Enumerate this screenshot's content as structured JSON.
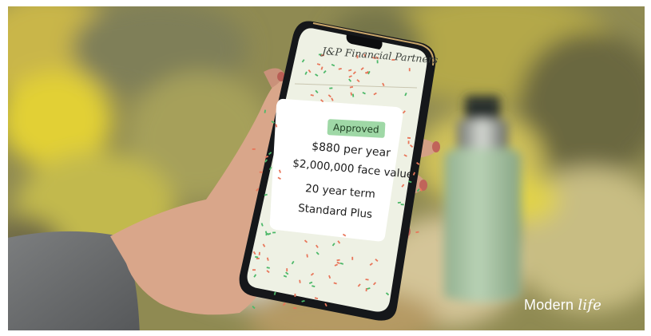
{
  "phone_screen": {
    "header_title": "J&P Financial Partners",
    "status_badge": "Approved",
    "details": [
      "$880 per year",
      "$2,000,000 face value",
      "20 year term",
      "Standard Plus"
    ]
  },
  "watermark": {
    "part1": "Modern ",
    "part2": "life"
  },
  "colors": {
    "screen_bg": "#eef1e4",
    "confetti_red": "#e8765a",
    "confetti_green": "#4cb868",
    "badge_bg": "#9fd8a6",
    "bottle": "#a9c5a7"
  }
}
